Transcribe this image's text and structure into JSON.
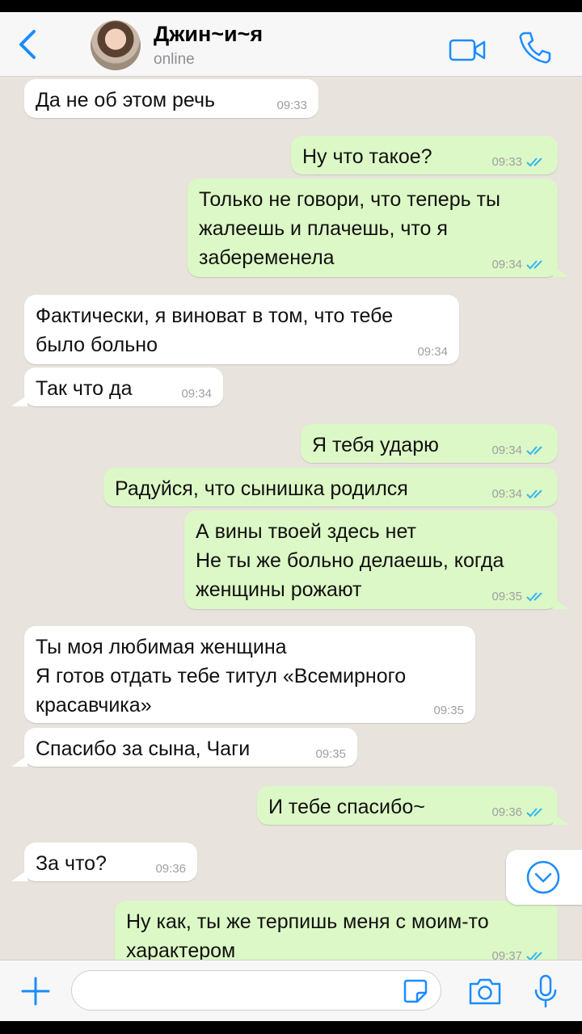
{
  "header": {
    "contact_name": "Джин~и~я",
    "status": "online"
  },
  "messages": [
    {
      "dir": "in",
      "text": "Да не об этом речь",
      "time": "09:33"
    },
    {
      "dir": "out",
      "text": "Ну что такое?",
      "time": "09:33",
      "read": true
    },
    {
      "dir": "out",
      "text": "Только не говори, что теперь ты\nжалеешь и плачешь, что я\nзабеременела",
      "time": "09:34",
      "read": true
    },
    {
      "dir": "in",
      "text": "Фактически, я виноват в том, что тебе\nбыло больно",
      "time": "09:34"
    },
    {
      "dir": "in",
      "text": "Так что да",
      "time": "09:34"
    },
    {
      "dir": "out",
      "text": "Я тебя ударю",
      "time": "09:34",
      "read": true
    },
    {
      "dir": "out",
      "text": "Радуйся, что сынишка родился",
      "time": "09:34",
      "read": true
    },
    {
      "dir": "out",
      "text": "А вины твоей здесь нет\nНе ты же больно делаешь, когда\nженщины рожают",
      "time": "09:35",
      "read": true
    },
    {
      "dir": "in",
      "text": "Ты моя любимая женщина\nЯ готов отдать тебе титул «Всемирного\nкрасавчика»",
      "time": "09:35"
    },
    {
      "dir": "in",
      "text": "Спасибо за сына, Чаги",
      "time": "09:35"
    },
    {
      "dir": "out",
      "text": "И тебе спасибо~",
      "time": "09:36",
      "read": true
    },
    {
      "dir": "in",
      "text": "За что?",
      "time": "09:36"
    },
    {
      "dir": "out",
      "text": "Ну как, ты же терпишь меня с моим-то\nхарактером",
      "time": "09:37",
      "read": true
    }
  ],
  "input": {
    "placeholder": "",
    "value": ""
  },
  "colors": {
    "accent": "#1a8cff",
    "chat_background": "#e8e3dc",
    "outgoing_bubble": "#dcf8c6",
    "incoming_bubble": "#ffffff",
    "read_ticks": "#34b7f1"
  },
  "icons": [
    "back-chevron-icon",
    "video-camera-icon",
    "phone-icon",
    "scroll-down-chevron-icon",
    "plus-icon",
    "sticker-icon",
    "camera-icon",
    "microphone-icon"
  ]
}
